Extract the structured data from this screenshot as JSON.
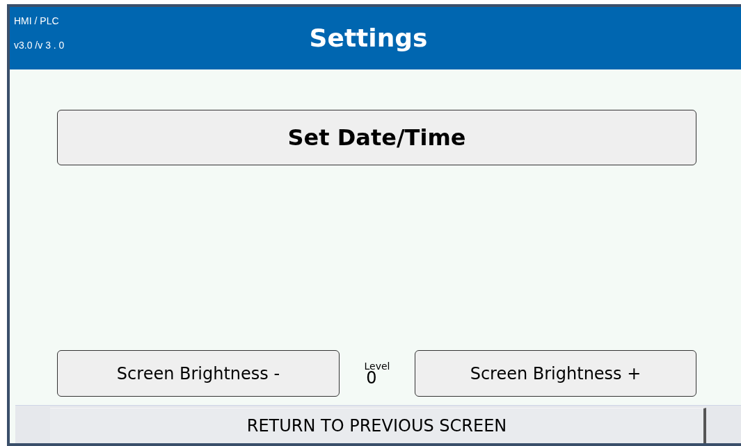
{
  "header": {
    "system_label": "HMI / PLC",
    "version": "v3.0 /v 3 . 0",
    "title": "Settings"
  },
  "set_datetime_button": "Set Date/Time",
  "brightness": {
    "decrease_button": "Screen Brightness -",
    "level_label": "Level",
    "level_value": "0",
    "increase_button": "Screen Brightness +"
  },
  "footer": {
    "return_button": "RETURN TO PREVIOUS SCREEN"
  }
}
